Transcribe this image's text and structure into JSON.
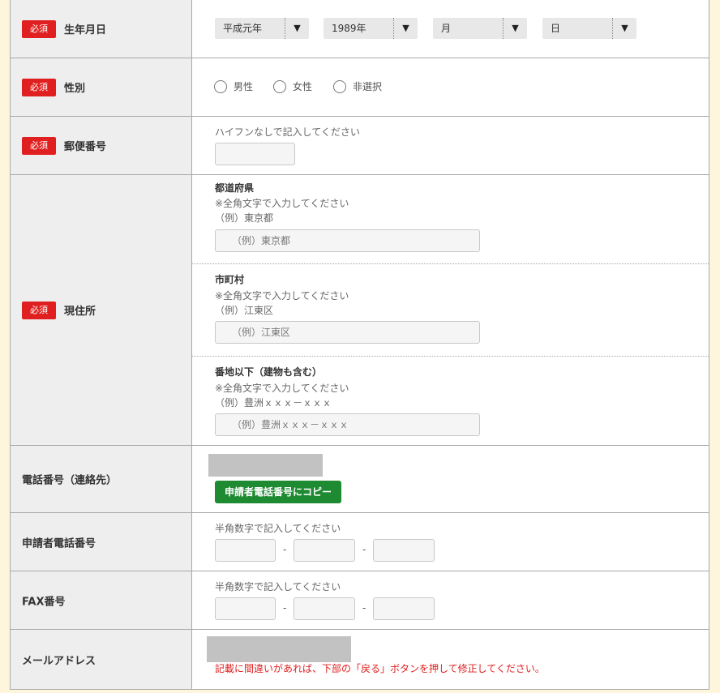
{
  "required_badge": "必須",
  "birth": {
    "label": "生年月日",
    "era": "平成元年",
    "year": "1989年",
    "month": "月",
    "day": "日",
    "arrow": "▼"
  },
  "gender": {
    "label": "性別",
    "options": [
      "男性",
      "女性",
      "非選択"
    ]
  },
  "postal": {
    "label": "郵便番号",
    "hint": "ハイフンなしで記入してください"
  },
  "address": {
    "label": "現住所",
    "prefecture": {
      "title": "都道府県",
      "hint": "※全角文字で入力してください",
      "example": "（例）東京都",
      "placeholder": "（例）東京都"
    },
    "city": {
      "title": "市町村",
      "hint": "※全角文字で入力してください",
      "example": "（例）江東区",
      "placeholder": "（例）江東区"
    },
    "street": {
      "title": "番地以下（建物も含む）",
      "hint": "※全角文字で入力してください",
      "example": "（例）豊洲ｘｘｘ－ｘｘｘ",
      "placeholder": "（例）豊洲ｘｘｘ－ｘｘｘ"
    }
  },
  "phone_contact": {
    "label": "電話番号（連絡先）",
    "copy_button": "申請者電話番号にコピー"
  },
  "applicant_phone": {
    "label": "申請者電話番号",
    "hint": "半角数字で記入してください",
    "dash": "-"
  },
  "fax": {
    "label": "FAX番号",
    "hint": "半角数字で記入してください",
    "dash": "-"
  },
  "email": {
    "label": "メールアドレス",
    "note": "記載に間違いがあれば、下部の「戻る」ボタンを押して修正してください。"
  }
}
